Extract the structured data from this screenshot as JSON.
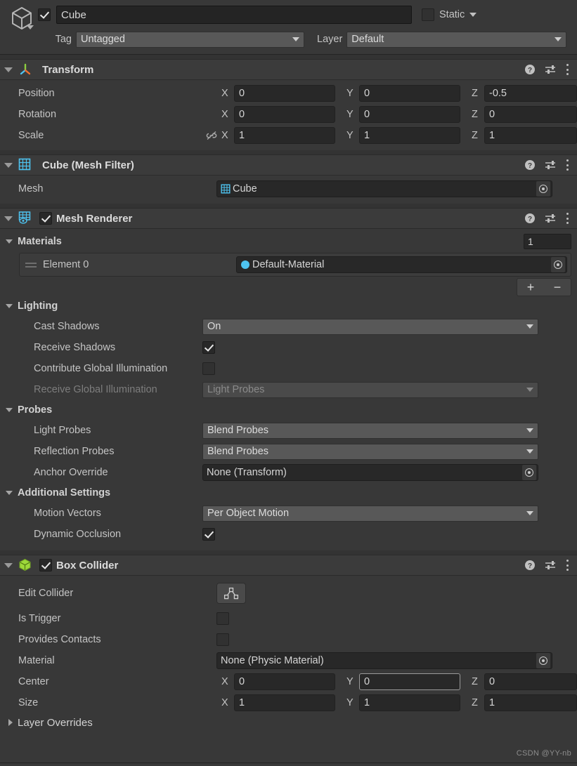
{
  "object_header": {
    "icon": "cube-gameobject-icon",
    "enabled": true,
    "name": "Cube",
    "static_label": "Static",
    "static_checked": false,
    "tag_label": "Tag",
    "tag_value": "Untagged",
    "layer_label": "Layer",
    "layer_value": "Default"
  },
  "components": [
    {
      "id": "transform",
      "title": "Transform",
      "icon": "transform-axis-icon",
      "has_enable_toggle": false,
      "expanded": true,
      "rows": [
        {
          "label": "Position",
          "x": "0",
          "y": "0",
          "z": "-0.5"
        },
        {
          "label": "Rotation",
          "x": "0",
          "y": "0",
          "z": "0"
        },
        {
          "label": "Scale",
          "x": "1",
          "y": "1",
          "z": "1",
          "lock_icon": "constrain-proportions-off-icon"
        }
      ]
    },
    {
      "id": "mesh-filter",
      "title": "Cube (Mesh Filter)",
      "icon": "mesh-filter-grid-icon",
      "has_enable_toggle": false,
      "expanded": true,
      "mesh_label": "Mesh",
      "mesh_value": "Cube"
    },
    {
      "id": "mesh-renderer",
      "title": "Mesh Renderer",
      "icon": "mesh-renderer-icon",
      "has_enable_toggle": true,
      "enabled": true,
      "expanded": true,
      "materials": {
        "section_label": "Materials",
        "count": "1",
        "element_label": "Element 0",
        "element_value": "Default-Material",
        "add_label": "+",
        "remove_label": "−"
      },
      "lighting": {
        "section_label": "Lighting",
        "cast_shadows_label": "Cast Shadows",
        "cast_shadows_value": "On",
        "receive_shadows_label": "Receive Shadows",
        "receive_shadows_checked": true,
        "contribute_gi_label": "Contribute Global Illumination",
        "contribute_gi_checked": false,
        "receive_gi_label": "Receive Global Illumination",
        "receive_gi_value": "Light Probes",
        "receive_gi_disabled": true
      },
      "probes": {
        "section_label": "Probes",
        "light_probes_label": "Light Probes",
        "light_probes_value": "Blend Probes",
        "reflection_probes_label": "Reflection Probes",
        "reflection_probes_value": "Blend Probes",
        "anchor_override_label": "Anchor Override",
        "anchor_override_value": "None (Transform)"
      },
      "additional": {
        "section_label": "Additional Settings",
        "motion_vectors_label": "Motion Vectors",
        "motion_vectors_value": "Per Object Motion",
        "dynamic_occlusion_label": "Dynamic Occlusion",
        "dynamic_occlusion_checked": true
      }
    },
    {
      "id": "box-collider",
      "title": "Box Collider",
      "icon": "box-collider-cube-icon",
      "has_enable_toggle": true,
      "enabled": true,
      "expanded": true,
      "edit_collider_label": "Edit Collider",
      "edit_collider_icon": "edit-collider-polygon-icon",
      "is_trigger_label": "Is Trigger",
      "is_trigger_checked": false,
      "provides_contacts_label": "Provides Contacts",
      "provides_contacts_checked": false,
      "material_label": "Material",
      "material_value": "None (Physic Material)",
      "center_label": "Center",
      "center": {
        "x": "0",
        "y": "0",
        "z": "0",
        "focused_axis": "y"
      },
      "size_label": "Size",
      "size": {
        "x": "1",
        "y": "1",
        "z": "1"
      },
      "layer_overrides_label": "Layer Overrides",
      "layer_overrides_expanded": false
    }
  ],
  "axis_labels": {
    "x": "X",
    "y": "Y",
    "z": "Z"
  },
  "header_icons": {
    "help": "help-icon",
    "preset": "preset-settings-icon",
    "menu": "kebab-menu-icon"
  },
  "watermark": "CSDN @YY-nb",
  "colors": {
    "panel_bg": "#383838",
    "header_bg": "#3b3b3b",
    "field_bg": "#282828",
    "dropdown_bg": "#585858",
    "text": "#c4c4c4",
    "accent_blue": "#4ec3f0",
    "accent_green": "#8cc63f"
  }
}
